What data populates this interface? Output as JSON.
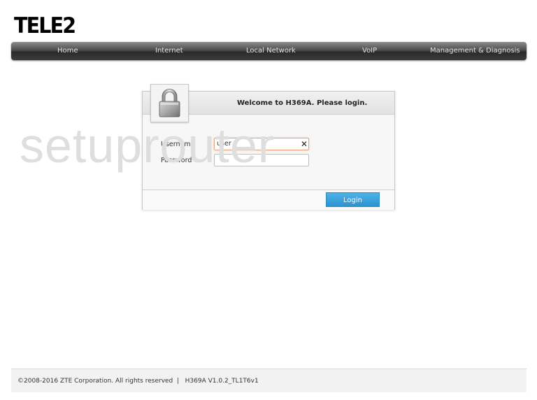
{
  "brand": {
    "logo_text": "TELE2"
  },
  "nav": {
    "items": [
      {
        "label": "Home"
      },
      {
        "label": "Internet"
      },
      {
        "label": "Local Network"
      },
      {
        "label": "VoIP"
      },
      {
        "label": "Management & Diagnosis"
      }
    ]
  },
  "watermark": {
    "text": "setuprouter"
  },
  "login": {
    "title": "Welcome to H369A. Please login.",
    "username_label": "Username",
    "username_value": "user",
    "password_label": "Password",
    "password_value": "",
    "clear_glyph": "✕",
    "button_label": "Login"
  },
  "footer": {
    "copyright": "©2008-2016 ZTE Corporation. All rights reserved",
    "separator": "|",
    "version": "H369A V1.0.2_TL1T6v1"
  },
  "colors": {
    "nav_bg": "#3c3c3c",
    "button_bg": "#2b93d0",
    "focus_border": "#e7a47a"
  }
}
